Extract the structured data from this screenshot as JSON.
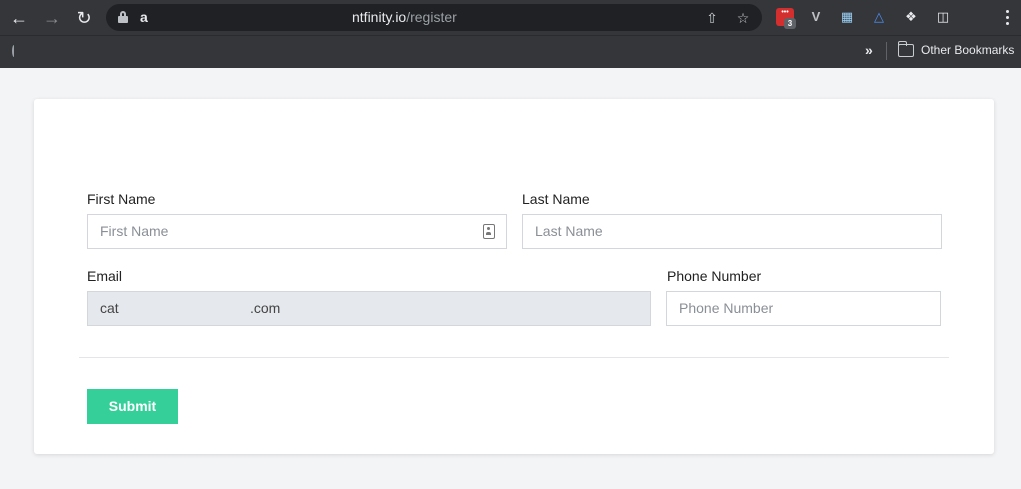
{
  "browser": {
    "url_prefix": "a",
    "url_host": "ntfinity.io",
    "url_path": "/register",
    "ext_badge_count": "3",
    "ext_red_label": "•••",
    "overflow_chevron": "»",
    "other_bookmarks_label": "Other Bookmarks"
  },
  "icons": {
    "back": "back-arrow-icon",
    "forward": "forward-arrow-icon",
    "reload": "reload-icon",
    "lock": "lock-icon",
    "share": "share-icon",
    "star": "star-icon",
    "puzzle": "extensions-puzzle-icon",
    "sidepanel": "side-panel-icon",
    "folder": "folder-icon",
    "contact": "contact-card-icon"
  },
  "form": {
    "first_name": {
      "label": "First Name",
      "placeholder": "First Name"
    },
    "last_name": {
      "label": "Last Name",
      "placeholder": "Last Name"
    },
    "email": {
      "label": "Email",
      "value_start": "cat",
      "value_end": ".com"
    },
    "phone": {
      "label": "Phone Number",
      "placeholder": "Phone Number"
    },
    "submit_label": "Submit"
  },
  "colors": {
    "submit_bg": "#35d09a",
    "chrome_bg": "#35363a",
    "page_bg": "#f3f4f6"
  }
}
